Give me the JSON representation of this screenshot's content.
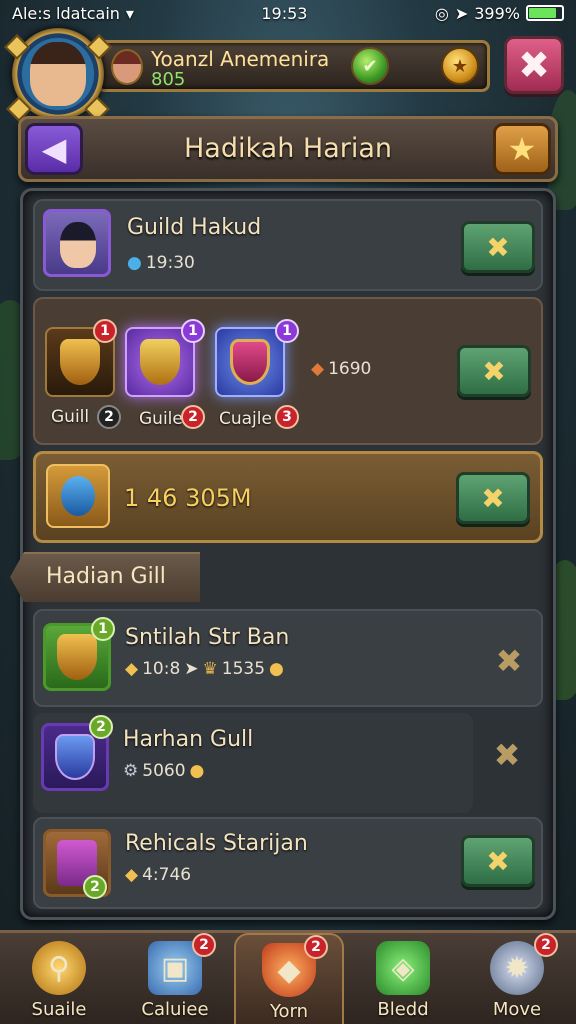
{
  "status": {
    "carrier": "Ale:s ldatcain",
    "time": "19:53",
    "battery": "399%"
  },
  "profile": {
    "name": "Yoanzl Anemenira",
    "level": "805"
  },
  "title": "Hadikah Harian",
  "rows": {
    "guild": {
      "title": "Guild Hakud",
      "sub": "19:30"
    },
    "rewards": [
      {
        "label": "Guill",
        "badge_top": "1",
        "badge_bottom": "2",
        "color": "#d49a2a"
      },
      {
        "label": "Guile",
        "badge_top": "1",
        "badge_bottom": "2",
        "color": "#9a4ad6"
      },
      {
        "label": "Cuajle",
        "badge_top": "1",
        "badge_bottom": "3",
        "color": "#4a6ad6"
      }
    ],
    "reward_amount": "1690",
    "gold": {
      "value": "1 46 305M"
    }
  },
  "section_header": "Hadian Gill",
  "list": [
    {
      "title": "Sntilah Str  Ban",
      "sub1": "10:8",
      "sub2": "1535",
      "badge": "1",
      "icon_color": "#3a8a2a",
      "action": "dismiss"
    },
    {
      "title": "Harhan Gull",
      "sub1": "5060",
      "badge": "2",
      "icon_color": "#6a3ab6",
      "action": "dismiss"
    },
    {
      "title": "Rehicals Starijan",
      "sub1": "4:746",
      "badge": "2",
      "icon_color": "#8a5a2a",
      "action": "claim"
    }
  ],
  "nav": [
    {
      "label": "Suaile",
      "badge": "",
      "icon": "magnifier-icon",
      "color": "#d8a030"
    },
    {
      "label": "Caluiee",
      "badge": "2",
      "icon": "chest-icon",
      "color": "#5a8ad6"
    },
    {
      "label": "Yorn",
      "badge": "2",
      "icon": "shield-icon",
      "color": "#e05a2a"
    },
    {
      "label": "Bledd",
      "badge": "",
      "icon": "gem-icon",
      "color": "#4ab84a"
    },
    {
      "label": "Move",
      "badge": "2",
      "icon": "spike-icon",
      "color": "#9aa8c8"
    }
  ]
}
